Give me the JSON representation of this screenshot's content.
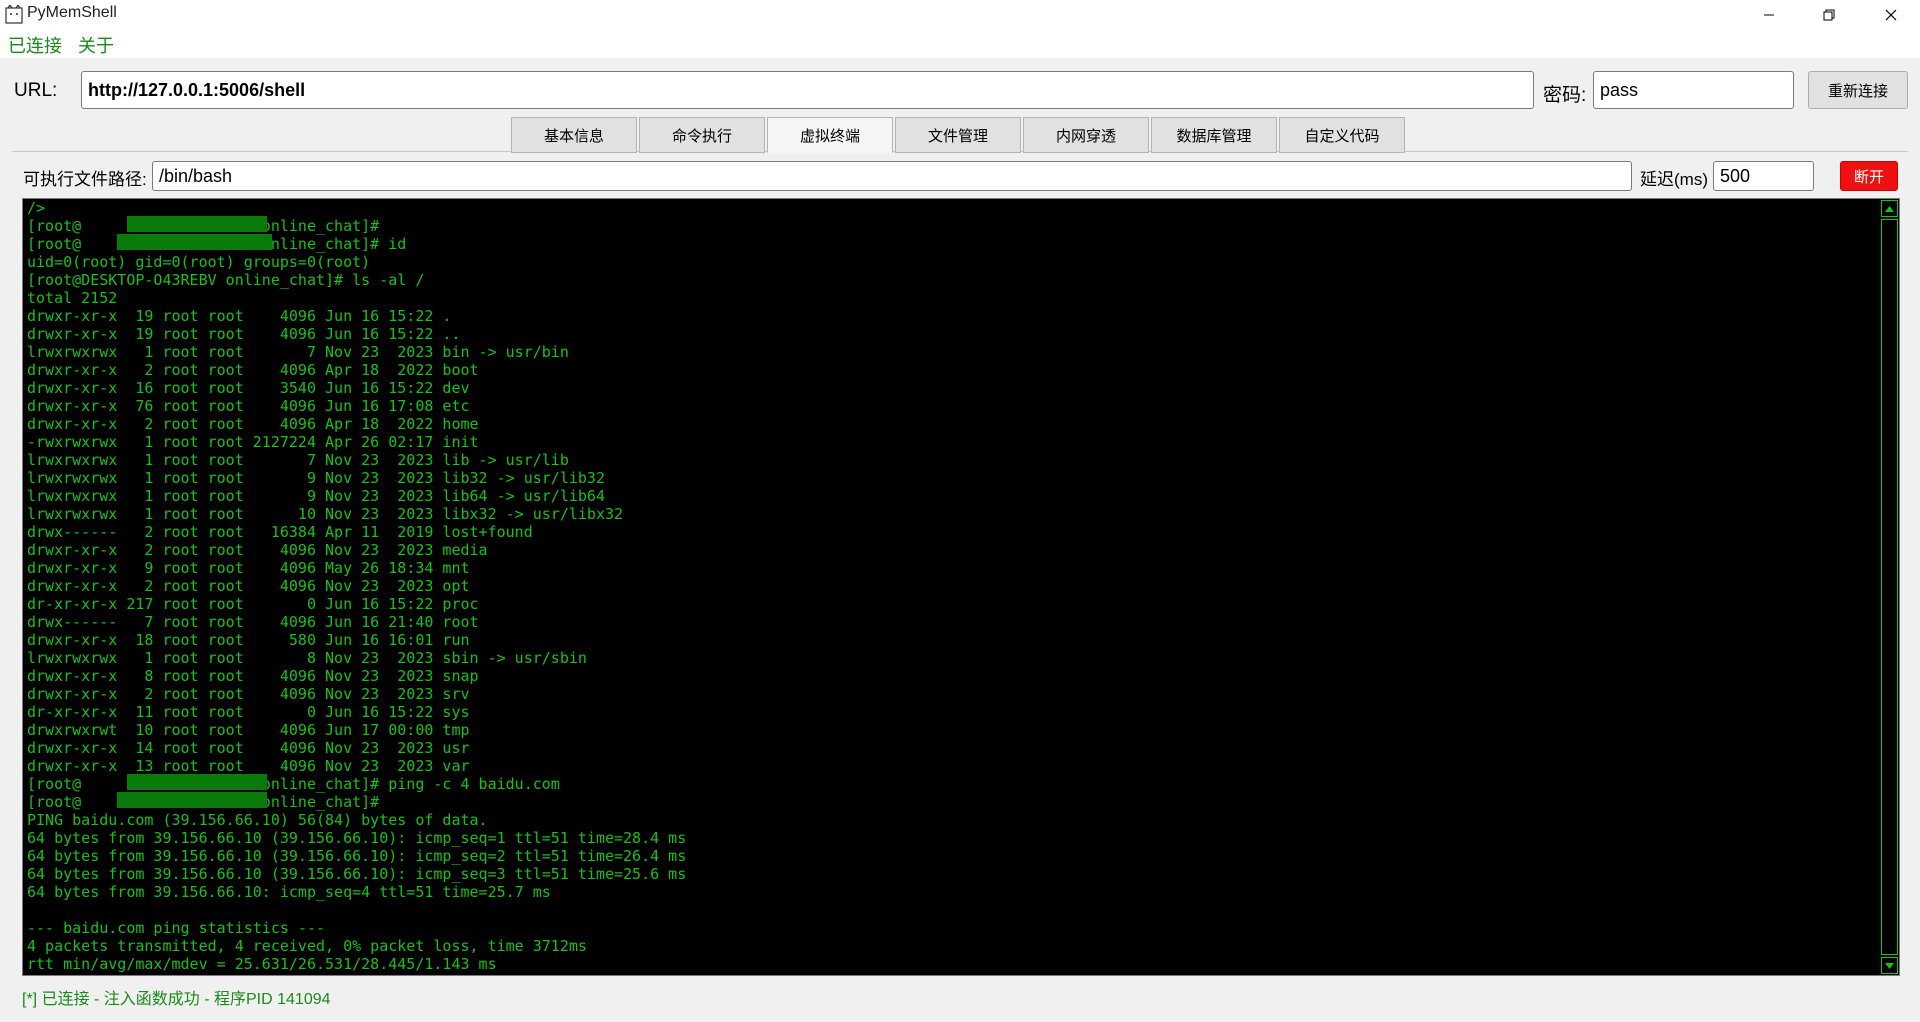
{
  "window": {
    "title": "PyMemShell",
    "icon": "app-icon",
    "controls": [
      "minimize-icon",
      "restore-icon",
      "close-icon"
    ]
  },
  "menu": [
    "已连接",
    "关于"
  ],
  "connection": {
    "url_label": "URL:",
    "url_value": "http://127.0.0.1:5006/shell",
    "password_label": "密码:",
    "password_value": "pass",
    "reconnect_label": "重新连接"
  },
  "tabs": [
    {
      "label": "基本信息",
      "active": false
    },
    {
      "label": "命令执行",
      "active": false
    },
    {
      "label": "虚拟终端",
      "active": true
    },
    {
      "label": "文件管理",
      "active": false
    },
    {
      "label": "内网穿透",
      "active": false
    },
    {
      "label": "数据库管理",
      "active": false
    },
    {
      "label": "自定义代码",
      "active": false
    }
  ],
  "terminal_settings": {
    "path_label": "可执行文件路径:",
    "path_value": "/bin/bash",
    "delay_label": "延迟(ms)",
    "delay_value": "500",
    "disconnect_label": "断开"
  },
  "terminal": {
    "text_color": "#19c019",
    "background": "#000000",
    "lines": [
      "/>",
      "[root@                    online_chat]#",
      "[root@                    online_chat]# id",
      "uid=0(root) gid=0(root) groups=0(root)",
      "[root@DESKTOP-O43REBV online_chat]# ls -al /",
      "total 2152",
      "drwxr-xr-x  19 root root    4096 Jun 16 15:22 .",
      "drwxr-xr-x  19 root root    4096 Jun 16 15:22 ..",
      "lrwxrwxrwx   1 root root       7 Nov 23  2023 bin -> usr/bin",
      "drwxr-xr-x   2 root root    4096 Apr 18  2022 boot",
      "drwxr-xr-x  16 root root    3540 Jun 16 15:22 dev",
      "drwxr-xr-x  76 root root    4096 Jun 16 17:08 etc",
      "drwxr-xr-x   2 root root    4096 Apr 18  2022 home",
      "-rwxrwxrwx   1 root root 2127224 Apr 26 02:17 init",
      "lrwxrwxrwx   1 root root       7 Nov 23  2023 lib -> usr/lib",
      "lrwxrwxrwx   1 root root       9 Nov 23  2023 lib32 -> usr/lib32",
      "lrwxrwxrwx   1 root root       9 Nov 23  2023 lib64 -> usr/lib64",
      "lrwxrwxrwx   1 root root      10 Nov 23  2023 libx32 -> usr/libx32",
      "drwx------   2 root root   16384 Apr 11  2019 lost+found",
      "drwxr-xr-x   2 root root    4096 Nov 23  2023 media",
      "drwxr-xr-x   9 root root    4096 May 26 18:34 mnt",
      "drwxr-xr-x   2 root root    4096 Nov 23  2023 opt",
      "dr-xr-xr-x 217 root root       0 Jun 16 15:22 proc",
      "drwx------   7 root root    4096 Jun 16 21:40 root",
      "drwxr-xr-x  18 root root     580 Jun 16 16:01 run",
      "lrwxrwxrwx   1 root root       8 Nov 23  2023 sbin -> usr/sbin",
      "drwxr-xr-x   8 root root    4096 Nov 23  2023 snap",
      "drwxr-xr-x   2 root root    4096 Nov 23  2023 srv",
      "dr-xr-xr-x  11 root root       0 Jun 16 15:22 sys",
      "drwxrwxrwt  10 root root    4096 Jun 17 00:00 tmp",
      "drwxr-xr-x  14 root root    4096 Nov 23  2023 usr",
      "drwxr-xr-x  13 root root    4096 Nov 23  2023 var",
      "[root@                    online_chat]# ping -c 4 baidu.com",
      "[root@                    online_chat]#",
      "PING baidu.com (39.156.66.10) 56(84) bytes of data.",
      "64 bytes from 39.156.66.10 (39.156.66.10): icmp_seq=1 ttl=51 time=28.4 ms",
      "64 bytes from 39.156.66.10 (39.156.66.10): icmp_seq=2 ttl=51 time=26.4 ms",
      "64 bytes from 39.156.66.10 (39.156.66.10): icmp_seq=3 ttl=51 time=25.6 ms",
      "64 bytes from 39.156.66.10: icmp_seq=4 ttl=51 time=25.7 ms",
      "",
      "--- baidu.com ping statistics ---",
      "4 packets transmitted, 4 received, 0% packet loss, time 3712ms",
      "rtt min/avg/max/mdev = 25.631/26.531/28.445/1.143 ms"
    ]
  },
  "status_bar": "[*] 已连接 - 注入函数成功 - 程序PID 141094"
}
